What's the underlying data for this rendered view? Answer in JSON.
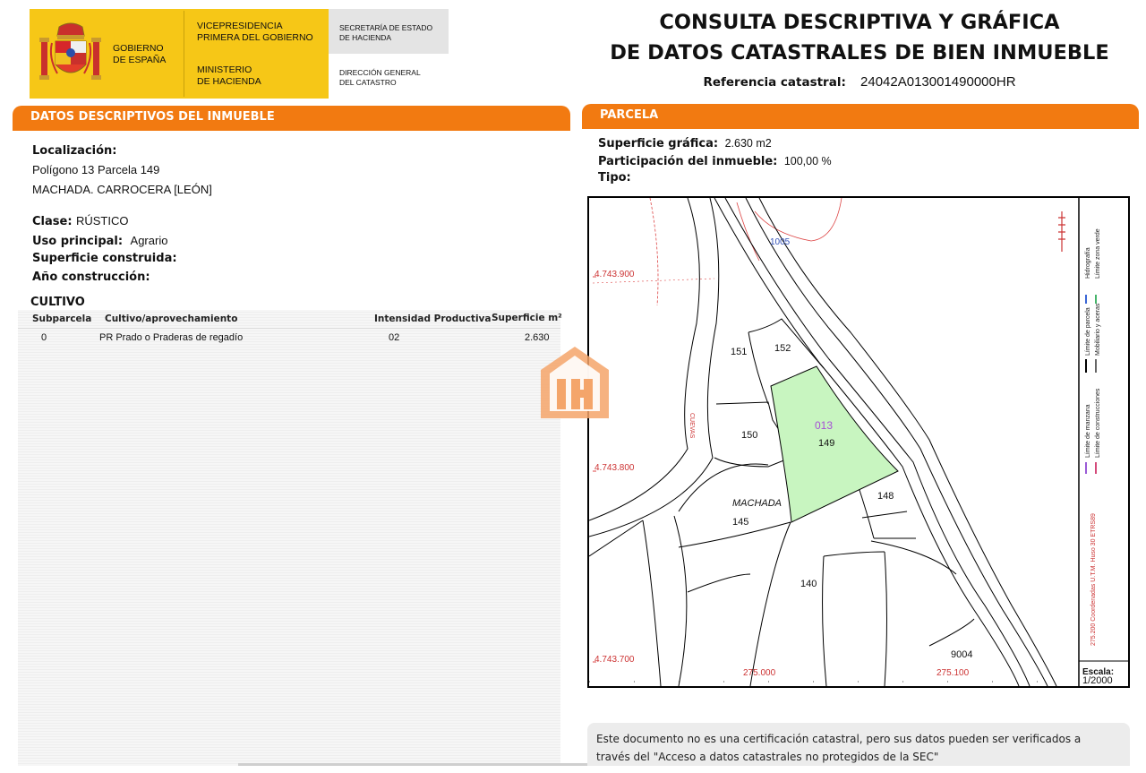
{
  "header": {
    "org_gobierno": [
      "GOBIERNO",
      "DE ESPAÑA"
    ],
    "org_vicepresidencia": [
      "VICEPRESIDENCIA",
      "PRIMERA DEL GOBIERNO"
    ],
    "org_ministerio": [
      "MINISTERIO",
      "DE HACIENDA"
    ],
    "org_secretaria": [
      "SECRETARÍA DE ESTADO",
      "DE HACIENDA"
    ],
    "org_direccion": [
      "DIRECCIÓN GENERAL",
      "DEL CATASTRO"
    ],
    "title_line1": "CONSULTA DESCRIPTIVA Y GRÁFICA",
    "title_line2": "DE DATOS CATASTRALES DE BIEN INMUEBLE",
    "ref_label": "Referencia catastral:",
    "ref_value": "24042A013001490000HR"
  },
  "descriptivos": {
    "section_title": "DATOS DESCRIPTIVOS DEL INMUEBLE",
    "localizacion_label": "Localización:",
    "localizacion_line1": "Polígono 13 Parcela 149",
    "localizacion_line2": "MACHADA. CARROCERA [LEÓN]",
    "clase_label": "Clase:",
    "clase_value": "RÚSTICO",
    "uso_label": "Uso principal:",
    "uso_value": "Agrario",
    "superficie_construida_label": "Superficie construida:",
    "anio_label": "Año construcción:"
  },
  "cultivo": {
    "title": "CULTIVO",
    "columns": [
      "Subparcela",
      "Cultivo/aprovechamiento",
      "Intensidad Productiva",
      "Superficie m²"
    ],
    "rows": [
      {
        "subparcela": "0",
        "cultivo": "PR Prado o Praderas de regadío",
        "intensidad": "02",
        "superficie": "2.630"
      }
    ]
  },
  "parcela": {
    "section_title": "PARCELA",
    "superficie_label": "Superficie gráfica:",
    "superficie_value": "2.630 m2",
    "participacion_label": "Participación del inmueble:",
    "participacion_value": "100,00 %",
    "tipo_label": "Tipo:"
  },
  "map": {
    "y_coords": [
      "4.743.900",
      "4.743.800",
      "4.743.700"
    ],
    "x_coords": [
      "275.000",
      "275.100"
    ],
    "parcel_labels": [
      "1005",
      "151",
      "152",
      "013",
      "149",
      "150",
      "148",
      "MACHADA",
      "145",
      "140",
      "9004",
      "CUEVAS"
    ],
    "legend": {
      "hidrografia": "Hidrografía",
      "limite_zona_verde": "Límite zona verde",
      "limite_parcela": "Límite de parcela",
      "mobiliario": "Mobiliario y aceras",
      "limite_manzana": "Límite de manzana",
      "limite_construcciones": "Límite de construcciones",
      "coordenadas": "275.200 Coordenadas U.T.M. Huso 30 ETRS89"
    },
    "escala_label": "Escala:",
    "escala_value": "1/2000",
    "highlight_color": "#c8f5c0",
    "accent_color": "#f27a11"
  },
  "footer": {
    "line1": "Este documento no es una certificación catastral, pero sus datos pueden ser verificados a",
    "line2": "través del \"Acceso a datos catastrales no protegidos de la SEC\""
  }
}
